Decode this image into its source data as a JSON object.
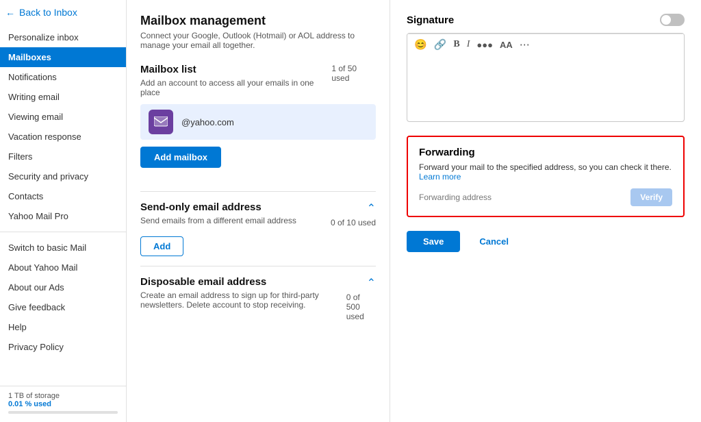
{
  "sidebar": {
    "back_label": "Back to Inbox",
    "items": [
      {
        "id": "personalize",
        "label": "Personalize inbox",
        "active": false
      },
      {
        "id": "mailboxes",
        "label": "Mailboxes",
        "active": true
      },
      {
        "id": "notifications",
        "label": "Notifications",
        "active": false
      },
      {
        "id": "writing",
        "label": "Writing email",
        "active": false
      },
      {
        "id": "viewing",
        "label": "Viewing email",
        "active": false
      },
      {
        "id": "vacation",
        "label": "Vacation response",
        "active": false
      },
      {
        "id": "filters",
        "label": "Filters",
        "active": false
      },
      {
        "id": "security",
        "label": "Security and privacy",
        "active": false
      },
      {
        "id": "contacts",
        "label": "Contacts",
        "active": false
      },
      {
        "id": "yahoo-pro",
        "label": "Yahoo Mail Pro",
        "active": false
      }
    ],
    "secondary_items": [
      {
        "id": "switch-basic",
        "label": "Switch to basic Mail"
      },
      {
        "id": "about-yahoo",
        "label": "About Yahoo Mail"
      },
      {
        "id": "about-ads",
        "label": "About our Ads"
      },
      {
        "id": "give-feedback",
        "label": "Give feedback"
      },
      {
        "id": "help",
        "label": "Help"
      },
      {
        "id": "privacy-policy",
        "label": "Privacy Policy"
      }
    ],
    "footer": {
      "storage_label": "1 TB of storage",
      "used_label": "0.01 % used"
    }
  },
  "main": {
    "title": "Mailbox management",
    "subtitle": "Connect your Google, Outlook (Hotmail) or AOL address to manage your email all together.",
    "mailbox_list": {
      "heading": "Mailbox list",
      "desc": "Add an account to access all your emails in one place",
      "count": "1 of 50 used",
      "account_email": "@yahoo.com",
      "add_label": "Add mailbox"
    },
    "send_only": {
      "heading": "Send-only email address",
      "desc": "Send emails from a different email address",
      "count": "0 of 10 used",
      "add_label": "Add"
    },
    "disposable": {
      "heading": "Disposable email address",
      "desc": "Create an email address to sign up for third-party newsletters. Delete account to stop receiving.",
      "count": "0 of 500 used"
    }
  },
  "right_panel": {
    "signature": {
      "title": "Signature",
      "toolbar": {
        "emoji": "😊",
        "link": "🔗",
        "bold": "B",
        "italic": "I",
        "color": "🎨",
        "font_size": "AA",
        "more": "···"
      }
    },
    "forwarding": {
      "title": "Forwarding",
      "desc": "Forward your mail to the specified address, so you can check it there.",
      "learn_more_label": "Learn more",
      "address_placeholder": "Forwarding address",
      "verify_label": "Verify"
    },
    "save_label": "Save",
    "cancel_label": "Cancel"
  }
}
